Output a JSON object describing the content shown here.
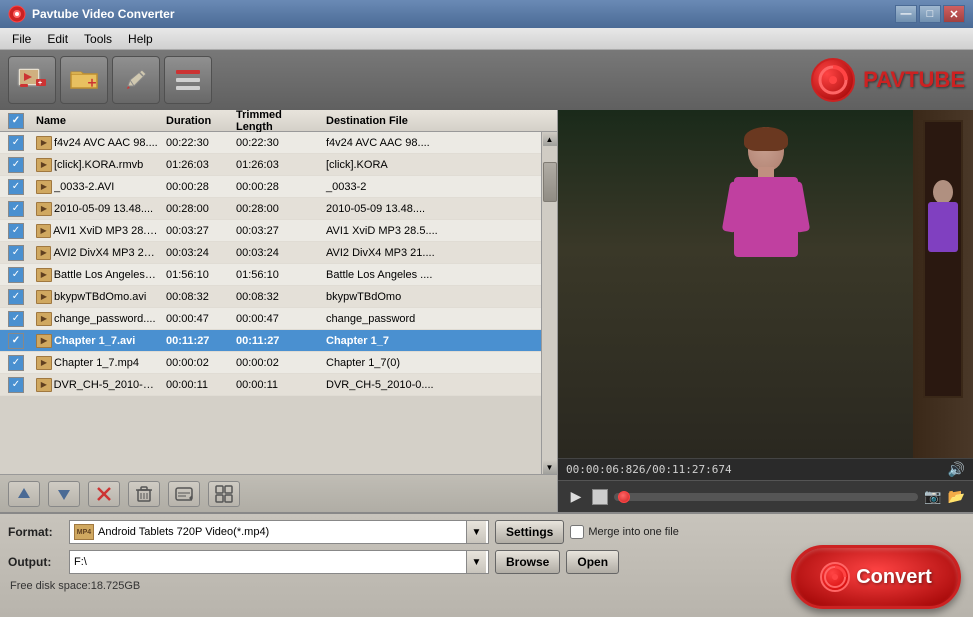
{
  "titleBar": {
    "title": "Pavtube Video Converter",
    "controls": {
      "minimize": "—",
      "maximize": "□",
      "close": "✕"
    }
  },
  "menuBar": {
    "items": [
      "File",
      "Edit",
      "Tools",
      "Help"
    ]
  },
  "toolbar": {
    "buttons": [
      {
        "id": "add-video",
        "icon": "🎬",
        "tooltip": "Add Video"
      },
      {
        "id": "add-folder",
        "icon": "📁",
        "tooltip": "Add Folder"
      },
      {
        "id": "edit",
        "icon": "✏️",
        "tooltip": "Edit"
      },
      {
        "id": "list",
        "icon": "☰",
        "tooltip": "List"
      }
    ],
    "logoText": "PAVTUBE"
  },
  "fileList": {
    "columns": [
      "",
      "Name",
      "Duration",
      "Trimmed Length",
      "Destination File"
    ],
    "rows": [
      {
        "checked": true,
        "name": "f4v24 AVC AAC 98....",
        "duration": "00:22:30",
        "trimmed": "00:22:30",
        "dest": "f4v24 AVC AAC 98...."
      },
      {
        "checked": true,
        "name": "[click].KORA.rmvb",
        "duration": "01:26:03",
        "trimmed": "01:26:03",
        "dest": "[click].KORA"
      },
      {
        "checked": true,
        "name": "_0033-2.AVI",
        "duration": "00:00:28",
        "trimmed": "00:00:28",
        "dest": "_0033-2"
      },
      {
        "checked": true,
        "name": "2010-05-09 13.48....",
        "duration": "00:28:00",
        "trimmed": "00:28:00",
        "dest": "2010-05-09 13.48...."
      },
      {
        "checked": true,
        "name": "AVI1 XviD MP3 28.5....",
        "duration": "00:03:27",
        "trimmed": "00:03:27",
        "dest": "AVI1 XviD MP3 28.5...."
      },
      {
        "checked": true,
        "name": "AVI2 DivX4 MP3 21....",
        "duration": "00:03:24",
        "trimmed": "00:03:24",
        "dest": "AVI2 DivX4 MP3 21...."
      },
      {
        "checked": true,
        "name": "Battle Los Angeles ....",
        "duration": "01:56:10",
        "trimmed": "01:56:10",
        "dest": "Battle Los Angeles ...."
      },
      {
        "checked": true,
        "name": "bkypwTBdOmo.avi",
        "duration": "00:08:32",
        "trimmed": "00:08:32",
        "dest": "bkypwTBdOmo"
      },
      {
        "checked": true,
        "name": "change_password....",
        "duration": "00:00:47",
        "trimmed": "00:00:47",
        "dest": "change_password"
      },
      {
        "checked": true,
        "name": "Chapter 1_7.avi",
        "duration": "00:11:27",
        "trimmed": "00:11:27",
        "dest": "Chapter 1_7",
        "selected": true
      },
      {
        "checked": true,
        "name": "Chapter 1_7.mp4",
        "duration": "00:00:02",
        "trimmed": "00:00:02",
        "dest": "Chapter 1_7(0)"
      },
      {
        "checked": true,
        "name": "DVR_CH-5_2010-0....",
        "duration": "00:00:11",
        "trimmed": "00:00:11",
        "dest": "DVR_CH-5_2010-0...."
      }
    ]
  },
  "actionBar": {
    "buttons": [
      {
        "id": "move-up",
        "icon": "↑"
      },
      {
        "id": "move-down",
        "icon": "↓"
      },
      {
        "id": "remove",
        "icon": "✕"
      },
      {
        "id": "delete",
        "icon": "🗑"
      },
      {
        "id": "subtitle",
        "icon": "💬"
      },
      {
        "id": "crop",
        "icon": "⊞"
      }
    ]
  },
  "videoPreview": {
    "timeCode": "00:00:06:826/00:11:27:674",
    "controls": {
      "play": "▶",
      "stop": "■"
    }
  },
  "bottomPanel": {
    "formatLabel": "Format:",
    "formatValue": "Android Tablets 720P Video(*.mp4)",
    "settingsLabel": "Settings",
    "mergeLabel": "Merge into one file",
    "outputLabel": "Output:",
    "outputValue": "F:\\",
    "browseLabel": "Browse",
    "openLabel": "Open",
    "diskSpace": "Free disk space:18.725GB",
    "convertLabel": "Convert"
  }
}
